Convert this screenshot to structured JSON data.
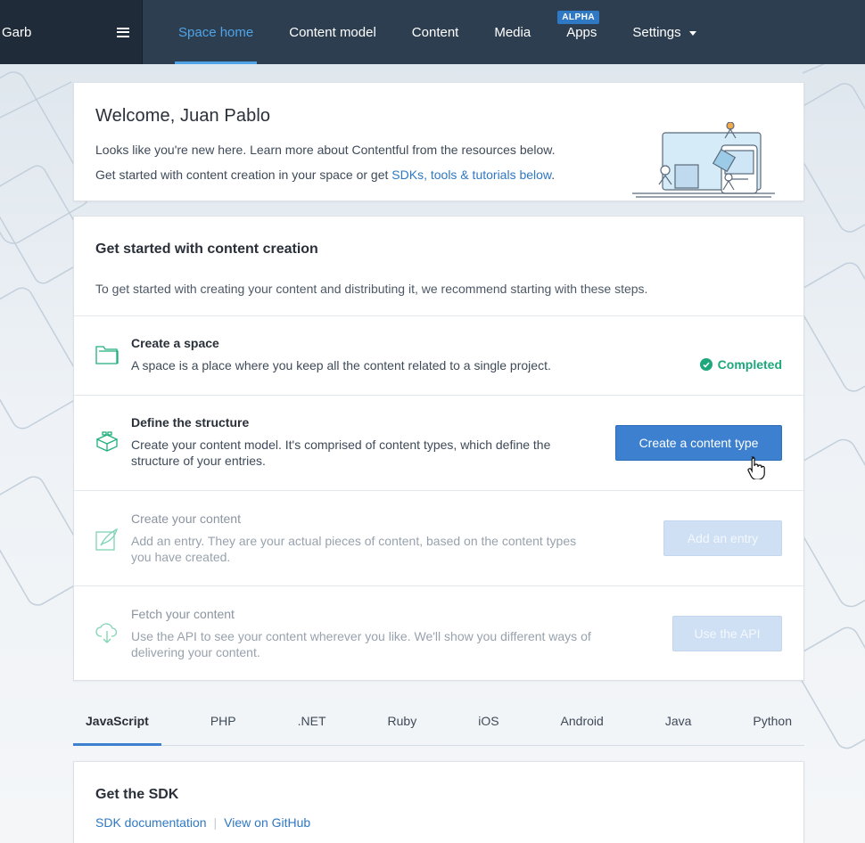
{
  "topbar": {
    "space_name": "Garb",
    "nav": [
      {
        "label": "Space home",
        "active": true
      },
      {
        "label": "Content model"
      },
      {
        "label": "Content"
      },
      {
        "label": "Media"
      },
      {
        "label": "Apps",
        "badge": "ALPHA"
      },
      {
        "label": "Settings"
      }
    ]
  },
  "welcome": {
    "title": "Welcome, Juan Pablo",
    "line1": "Looks like you're new here. Learn more about Contentful from the resources below.",
    "line2_prefix": "Get started with content creation in your space or get ",
    "line2_link": "SDKs, tools & tutorials below",
    "line2_suffix": "."
  },
  "get_started": {
    "title": "Get started with content creation",
    "intro": "To get started with creating your content and distributing it, we recommend starting with these steps.",
    "steps": [
      {
        "title": "Create a space",
        "desc": "A space is a place where you keep all the content related to a single project.",
        "status": "Completed",
        "icon": "folder-icon"
      },
      {
        "title": "Define the structure",
        "desc": "Create your content model. It's comprised of content types, which define the structure of your entries.",
        "button": "Create a content type",
        "icon": "blocks-icon"
      },
      {
        "title": "Create your content",
        "desc": "Add an entry. They are your actual pieces of content, based on the content types you have created.",
        "button": "Add an entry",
        "icon": "quill-icon"
      },
      {
        "title": "Fetch your content",
        "desc": "Use the API to see your content wherever you like. We'll show you different ways of delivering your content.",
        "button": "Use the API",
        "icon": "cloud-download-icon"
      }
    ]
  },
  "sdk_tabs": [
    "JavaScript",
    "PHP",
    ".NET",
    "Ruby",
    "iOS",
    "Android",
    "Java",
    "Python"
  ],
  "sdk": {
    "title": "Get the SDK",
    "doc_link": "SDK documentation",
    "github_link": "View on GitHub"
  },
  "colors": {
    "nav_bg": "#2d3e50",
    "accent": "#3c80cf",
    "success": "#1da77a"
  }
}
